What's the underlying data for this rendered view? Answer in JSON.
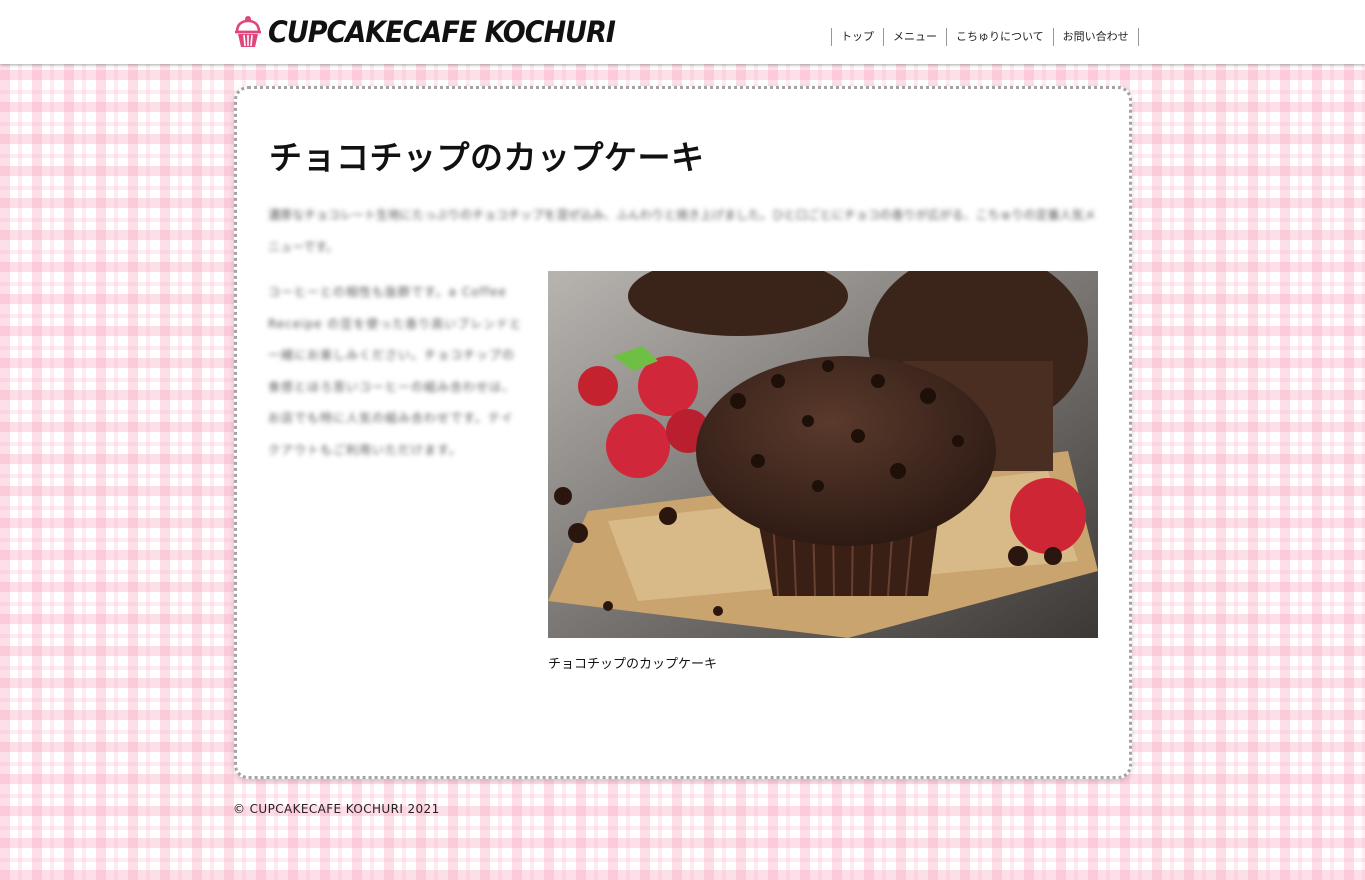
{
  "header": {
    "logo_text": "CUPCAKECAFE KOCHURI",
    "logo_icon": "cupcake-icon",
    "nav": [
      {
        "label": "トップ"
      },
      {
        "label": "メニュー"
      },
      {
        "label": "こちゅりについて"
      },
      {
        "label": "お問い合わせ"
      }
    ]
  },
  "article": {
    "title": "チョコチップのカップケーキ",
    "intro": "濃厚なチョコレート生地にたっぷりのチョコチップを混ぜ込み、ふんわりと焼き上げました。ひと口ごとにチョコの香りが広がる、こちゅりの定番人気メニューです。",
    "body": "コーヒーとの相性も抜群です。a Coffee Receipe の豆を使った香り高いブレンドと一緒にお楽しみください。チョコチップの食感とほろ苦いコーヒーの組み合わせは、お店でも特に人気の組み合わせです。テイクアウトもご利用いただけます。",
    "image_alt": "チョコチップのカップケーキ",
    "caption": "チョコチップのカップケーキ"
  },
  "footer": {
    "copyright": "© CUPCAKECAFE KOCHURI 2021"
  },
  "colors": {
    "accent_pink": "#e0457b",
    "gingham_pink": "#f9b3c8",
    "card_border": "#a3a3a3"
  }
}
